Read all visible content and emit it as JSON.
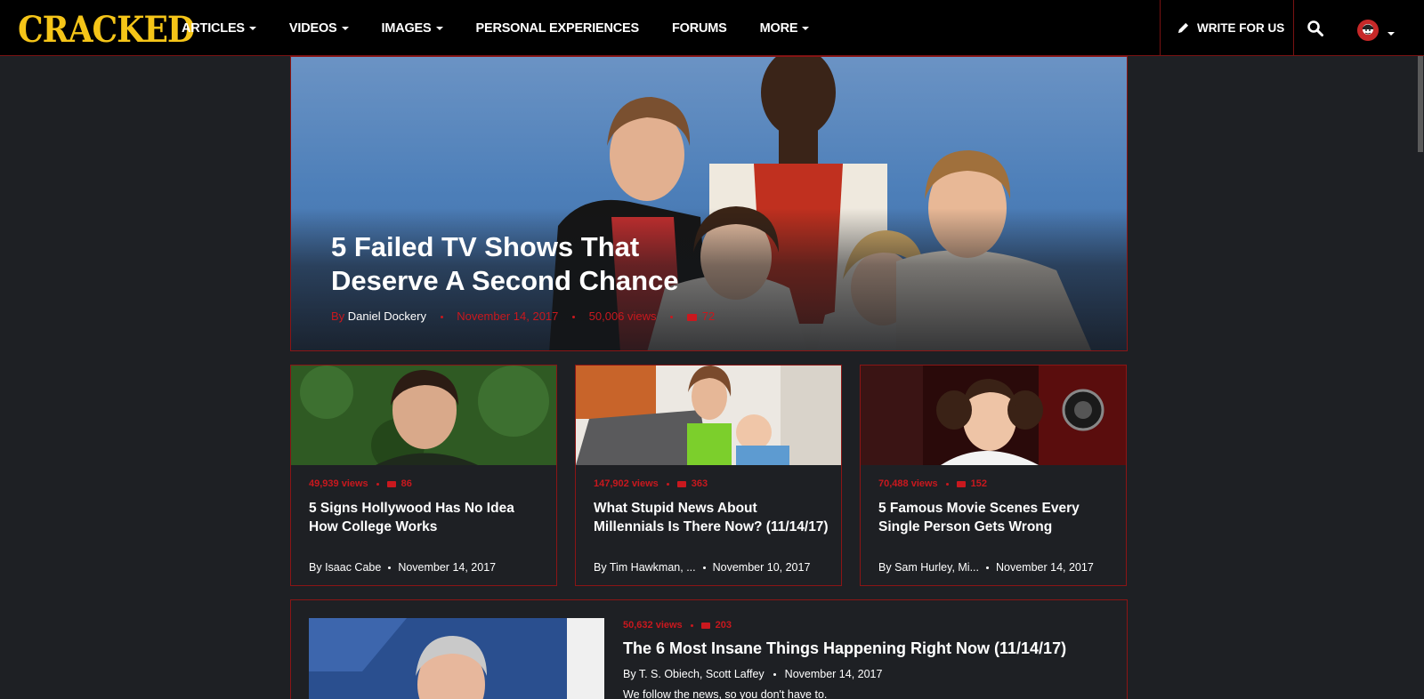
{
  "nav": {
    "logo": "CRACKED",
    "items": [
      {
        "label": "ARTICLES",
        "dropdown": true
      },
      {
        "label": "VIDEOS",
        "dropdown": true
      },
      {
        "label": "IMAGES",
        "dropdown": true
      },
      {
        "label": "PERSONAL EXPERIENCES",
        "dropdown": false
      },
      {
        "label": "FORUMS",
        "dropdown": false
      },
      {
        "label": "MORE",
        "dropdown": true
      }
    ],
    "write_label": "WRITE FOR US",
    "icons": {
      "write": "pencil-icon",
      "search": "search-icon",
      "user": "avatar-icon"
    }
  },
  "hero": {
    "title": "5 Failed TV Shows That Deserve A Second Chance",
    "by": "By",
    "author": "Daniel Dockery",
    "date": "November 14, 2017",
    "views": "50,006 views",
    "comments": "72"
  },
  "cards": [
    {
      "views": "49,939 views",
      "comments": "86",
      "title": "5 Signs Hollywood Has No Idea How College Works",
      "by": "By",
      "author": "Isaac Cabe",
      "date": "November 14, 2017"
    },
    {
      "views": "147,902 views",
      "comments": "363",
      "title": "What Stupid News About Millennials Is There Now? (11/14/17)",
      "by": "By",
      "author": "Tim Hawkman, ...",
      "date": "November 10, 2017"
    },
    {
      "views": "70,488 views",
      "comments": "152",
      "title": "5 Famous Movie Scenes Every Single Person Gets Wrong",
      "by": "By",
      "author": "Sam Hurley, Mi...",
      "date": "November 14, 2017"
    }
  ],
  "wide": {
    "views": "50,632 views",
    "comments": "203",
    "title": "The 6 Most Insane Things Happening Right Now (11/14/17)",
    "by": "By",
    "author": "T. S. Obiech, Scott Laffey",
    "date": "November 14, 2017",
    "description": "We follow the news, so you don't have to."
  },
  "colors": {
    "accent": "#c9181e",
    "logo": "#f5c518",
    "background": "#1e2024",
    "border": "#8b1515"
  }
}
